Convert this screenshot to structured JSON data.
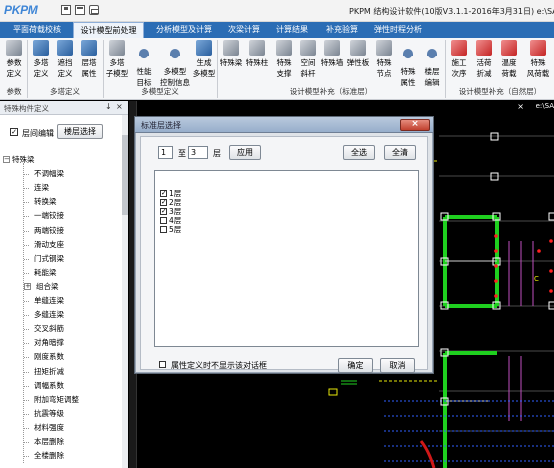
{
  "app": {
    "logo": "PKPM",
    "title": "PKPM 结构设计软件(10版V3.1.1-2016年3月31日) e:\\SA"
  },
  "tabs": [
    {
      "label": "平面荷载校核",
      "active": false
    },
    {
      "label": "设计模型前处理",
      "active": true
    },
    {
      "label": "分析模型及计算",
      "active": false
    },
    {
      "label": "次梁计算",
      "active": false
    },
    {
      "label": "计算结果",
      "active": false
    },
    {
      "label": "补充验算",
      "active": false
    },
    {
      "label": "弹性时程分析",
      "active": false
    }
  ],
  "ribbon": {
    "buttons": [
      {
        "label1": "参数",
        "label2": "定义",
        "icon": "parameters-icon"
      },
      {
        "label1": "多塔",
        "label2": "定义",
        "icon": "multi-tower-icon"
      },
      {
        "label1": "遮挡",
        "label2": "定义",
        "icon": "shelter-icon"
      },
      {
        "label1": "层塔",
        "label2": "属性",
        "icon": "floor-tower-icon"
      },
      {
        "label1": "多塔",
        "label2": "子模型",
        "icon": "sub-model-icon"
      },
      {
        "label1": "性能",
        "label2": "目标",
        "icon": "performance-target-icon"
      },
      {
        "label1": "多模型",
        "label2": "控制信息",
        "icon": "multi-model-icon"
      },
      {
        "label1": "生成",
        "label2": "多模型",
        "icon": "generate-model-icon"
      },
      {
        "label1": "特殊梁",
        "label2": "",
        "icon": "special-beam-icon"
      },
      {
        "label1": "特殊柱",
        "label2": "",
        "icon": "special-column-icon"
      },
      {
        "label1": "特殊",
        "label2": "支撑",
        "icon": "special-brace-icon"
      },
      {
        "label1": "空间",
        "label2": "斜杆",
        "icon": "space-diagonal-icon"
      },
      {
        "label1": "特殊墙",
        "label2": "",
        "icon": "special-wall-icon"
      },
      {
        "label1": "弹性板",
        "label2": "",
        "icon": "elastic-slab-icon"
      },
      {
        "label1": "特殊",
        "label2": "节点",
        "icon": "special-node-icon"
      },
      {
        "label1": "特殊",
        "label2": "属性",
        "icon": "special-property-icon"
      },
      {
        "label1": "楼层",
        "label2": "编辑",
        "icon": "floor-edit-icon"
      },
      {
        "label1": "施工",
        "label2": "次序",
        "icon": "construction-order-icon"
      },
      {
        "label1": "活荷",
        "label2": "折减",
        "icon": "live-load-reduction-icon"
      },
      {
        "label1": "温度",
        "label2": "荷载",
        "icon": "temperature-load-icon"
      },
      {
        "label1": "特殊",
        "label2": "风荷载",
        "icon": "wind-load-icon"
      }
    ],
    "groups": [
      "参数",
      "多塔定义",
      "多模型定义",
      "设计模型补充（标准层）",
      "设计模型补充（自然层）"
    ]
  },
  "panel": {
    "title": "特殊构件定义",
    "pin": "↓",
    "close": "×",
    "layer_edit_label": "层间编辑",
    "layer_edit_checked": true,
    "floor_select_button": "楼层选择",
    "tree": [
      {
        "label": "特殊梁",
        "level": 0,
        "expand": "−"
      },
      {
        "label": "不调幅梁",
        "level": 1
      },
      {
        "label": "连梁",
        "level": 1
      },
      {
        "label": "转换梁",
        "level": 1
      },
      {
        "label": "一端铰接",
        "level": 1
      },
      {
        "label": "两端铰接",
        "level": 1
      },
      {
        "label": "滑动支座",
        "level": 1
      },
      {
        "label": "门式钢梁",
        "level": 1
      },
      {
        "label": "耗能梁",
        "level": 1
      },
      {
        "label": "组合梁",
        "level": 1,
        "expand": "+"
      },
      {
        "label": "单缝连梁",
        "level": 1
      },
      {
        "label": "多缝连梁",
        "level": 1
      },
      {
        "label": "交叉斜筋",
        "level": 1
      },
      {
        "label": "对角暗撑",
        "level": 1
      },
      {
        "label": "刚度系数",
        "level": 1
      },
      {
        "label": "扭矩折减",
        "level": 1
      },
      {
        "label": "调幅系数",
        "level": 1
      },
      {
        "label": "附加弯矩调整",
        "level": 1
      },
      {
        "label": "抗震等级",
        "level": 1
      },
      {
        "label": "材料强度",
        "level": 1
      },
      {
        "label": "本层删除",
        "level": 1
      },
      {
        "label": "全楼删除",
        "level": 1
      }
    ]
  },
  "canvas": {
    "close": "×",
    "path": "e:\\SA",
    "axis_label": "C"
  },
  "dialog": {
    "title": "标准层选择",
    "close_glyph": "×",
    "from_value": "1",
    "to_label": "至",
    "to_value": "3",
    "unit": "层",
    "apply_button": "应用",
    "select_all_button": "全选",
    "clear_all_button": "全清",
    "floors": [
      {
        "label": "1层",
        "checked": true
      },
      {
        "label": "2层",
        "checked": true
      },
      {
        "label": "3层",
        "checked": true
      },
      {
        "label": "4层",
        "checked": false
      },
      {
        "label": "5层",
        "checked": false
      }
    ],
    "no_dialog_label": "属性定义时不显示该对话框",
    "ok_button": "确定",
    "cancel_button": "取消"
  },
  "colors": {
    "tab_bar": "#2b6db5",
    "canvas_bg": "#000000",
    "beam_green": "#1fd01f",
    "grid_yellow": "#e8e80a",
    "marker_red": "#ff2020",
    "grid_magenta": "#c050c0"
  }
}
